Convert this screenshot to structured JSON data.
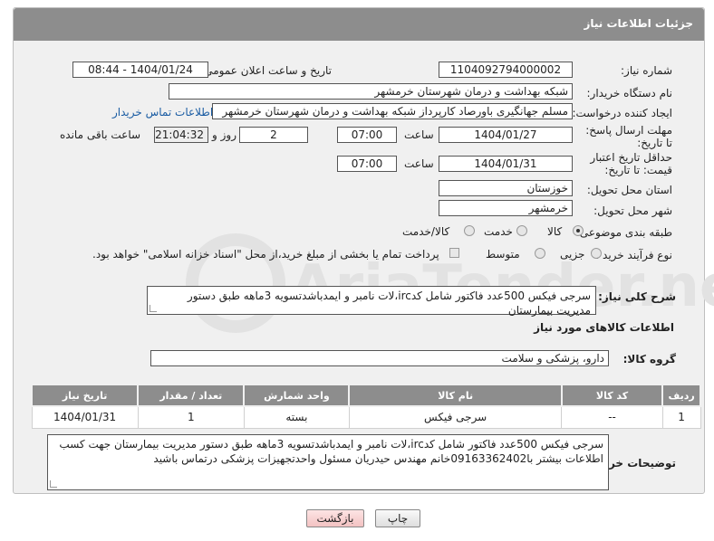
{
  "header": {
    "title": "جزئیات اطلاعات نیاز"
  },
  "fields": {
    "need_number_label": "شماره نیاز:",
    "need_number": "1104092794000002",
    "announce_label": "تاریخ و ساعت اعلان عمومی:",
    "announce_value": "1404/01/24 - 08:44",
    "buyer_org_label": "نام دستگاه خریدار:",
    "buyer_org": "شبکه بهداشت و درمان شهرستان خرمشهر",
    "creator_label": "ایجاد کننده درخواست:",
    "creator": "مسلم جهانگیری باورصاد کارپرداز شبکه بهداشت و درمان شهرستان خرمشهر",
    "contact_link": "اطلاعات تماس خریدار",
    "deadline_label": "مهلت ارسال پاسخ: تا تاریخ:",
    "deadline_date": "1404/01/27",
    "time_label": "ساعت",
    "deadline_time": "07:00",
    "days_value": "2",
    "days_label": "روز و",
    "remaining_time": "21:04:32",
    "remaining_label": "ساعت باقی مانده",
    "price_validity_label": "حداقل تاریخ اعتبار قیمت: تا تاریخ:",
    "price_validity_date": "1404/01/31",
    "price_validity_time": "07:00",
    "province_label": "استان محل تحویل:",
    "province": "خوزستان",
    "city_label": "شهر محل تحویل:",
    "city": "خرمشهر",
    "category_label": "طبقه بندی موضوعی:",
    "category_options": [
      "کالا",
      "خدمت",
      "کالا/خدمت"
    ],
    "process_label": "نوع فرآیند خرید :",
    "process_options": [
      "جزیی",
      "متوسط"
    ],
    "payment_note": "پرداخت تمام یا بخشی از مبلغ خرید،از محل \"اسناد خزانه اسلامی\" خواهد بود."
  },
  "summary": {
    "label": "شرح کلی نیاز:",
    "text": "سرجی فیکس 500عدد فاکتور شامل کدirc،لات نامبر و ایمدباشدتسویه 3ماهه طبق دستور مدیریت بیمارستان"
  },
  "goods": {
    "section_title": "اطلاعات کالاهای مورد نیاز",
    "group_label": "گروه کالا:",
    "group_value": "دارو، پزشکی و سلامت",
    "columns": [
      "ردیف",
      "کد کالا",
      "نام کالا",
      "واحد شمارش",
      "تعداد / مقدار",
      "تاریخ نیاز"
    ],
    "rows": [
      {
        "row": "1",
        "code": "--",
        "name": "سرجی فیکس",
        "unit": "بسته",
        "qty": "1",
        "date": "1404/01/31"
      }
    ]
  },
  "buyer_notes": {
    "label": "توضیحات خریدار:",
    "text": "سرجی فیکس 500عدد فاکتور شامل کدirc،لات نامبر و ایمدباشدتسویه 3ماهه طبق دستور مدیریت بیمارستان جهت کسب اطلاعات بیشتر با09163362402خانم مهندس حیدریان مسئول واحدتجهیزات پزشکی درتماس باشید"
  },
  "buttons": {
    "print": "چاپ",
    "back": "بازگشت"
  },
  "watermark": {
    "text": "AriaTender.neT",
    "color": "#e4e4e4"
  }
}
